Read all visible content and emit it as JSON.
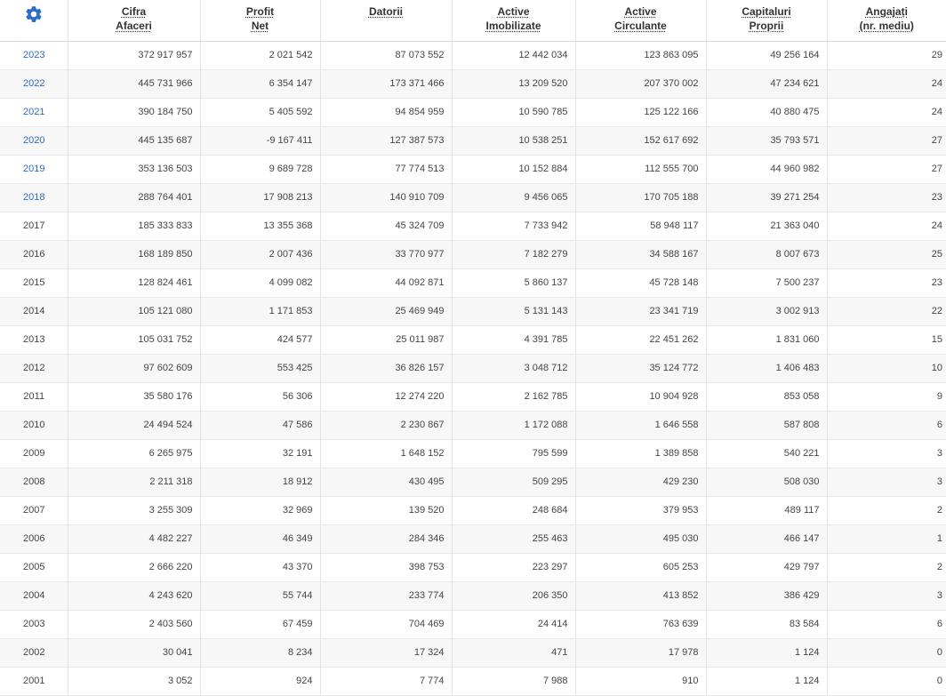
{
  "settings_icon": "gear-icon",
  "accent_color": "#2a6cc7",
  "columns": [
    {
      "line1": "Cifra",
      "line2": "Afaceri"
    },
    {
      "line1": "Profit",
      "line2": "Net"
    },
    {
      "line1": "Datorii",
      "line2": ""
    },
    {
      "line1": "Active",
      "line2": "Imobilizate"
    },
    {
      "line1": "Active",
      "line2": "Circulante"
    },
    {
      "line1": "Capitaluri",
      "line2": "Proprii"
    },
    {
      "line1": "Angajați",
      "line2": "(nr. mediu)"
    }
  ],
  "rows": [
    {
      "year": "2023",
      "link": true,
      "values": [
        "372 917 957",
        "2 021 542",
        "87 073 552",
        "12 442 034",
        "123 863 095",
        "49 256 164",
        "29"
      ]
    },
    {
      "year": "2022",
      "link": true,
      "values": [
        "445 731 966",
        "6 354 147",
        "173 371 466",
        "13 209 520",
        "207 370 002",
        "47 234 621",
        "24"
      ]
    },
    {
      "year": "2021",
      "link": true,
      "values": [
        "390 184 750",
        "5 405 592",
        "94 854 959",
        "10 590 785",
        "125 122 166",
        "40 880 475",
        "24"
      ]
    },
    {
      "year": "2020",
      "link": true,
      "values": [
        "445 135 687",
        "-9 167 411",
        "127 387 573",
        "10 538 251",
        "152 617 692",
        "35 793 571",
        "27"
      ]
    },
    {
      "year": "2019",
      "link": true,
      "values": [
        "353 136 503",
        "9 689 728",
        "77 774 513",
        "10 152 884",
        "112 555 700",
        "44 960 982",
        "27"
      ]
    },
    {
      "year": "2018",
      "link": true,
      "values": [
        "288 764 401",
        "17 908 213",
        "140 910 709",
        "9 456 065",
        "170 705 188",
        "39 271 254",
        "23"
      ]
    },
    {
      "year": "2017",
      "link": false,
      "values": [
        "185 333 833",
        "13 355 368",
        "45 324 709",
        "7 733 942",
        "58 948 117",
        "21 363 040",
        "24"
      ]
    },
    {
      "year": "2016",
      "link": false,
      "values": [
        "168 189 850",
        "2 007 436",
        "33 770 977",
        "7 182 279",
        "34 588 167",
        "8 007 673",
        "25"
      ]
    },
    {
      "year": "2015",
      "link": false,
      "values": [
        "128 824 461",
        "4 099 082",
        "44 092 871",
        "5 860 137",
        "45 728 148",
        "7 500 237",
        "23"
      ]
    },
    {
      "year": "2014",
      "link": false,
      "values": [
        "105 121 080",
        "1 171 853",
        "25 469 949",
        "5 131 143",
        "23 341 719",
        "3 002 913",
        "22"
      ]
    },
    {
      "year": "2013",
      "link": false,
      "values": [
        "105 031 752",
        "424 577",
        "25 011 987",
        "4 391 785",
        "22 451 262",
        "1 831 060",
        "15"
      ]
    },
    {
      "year": "2012",
      "link": false,
      "values": [
        "97 602 609",
        "553 425",
        "36 826 157",
        "3 048 712",
        "35 124 772",
        "1 406 483",
        "10"
      ]
    },
    {
      "year": "2011",
      "link": false,
      "values": [
        "35 580 176",
        "56 306",
        "12 274 220",
        "2 162 785",
        "10 904 928",
        "853 058",
        "9"
      ]
    },
    {
      "year": "2010",
      "link": false,
      "values": [
        "24 494 524",
        "47 586",
        "2 230 867",
        "1 172 088",
        "1 646 558",
        "587 808",
        "6"
      ]
    },
    {
      "year": "2009",
      "link": false,
      "values": [
        "6 265 975",
        "32 191",
        "1 648 152",
        "795 599",
        "1 389 858",
        "540 221",
        "3"
      ]
    },
    {
      "year": "2008",
      "link": false,
      "values": [
        "2 211 318",
        "18 912",
        "430 495",
        "509 295",
        "429 230",
        "508 030",
        "3"
      ]
    },
    {
      "year": "2007",
      "link": false,
      "values": [
        "3 255 309",
        "32 969",
        "139 520",
        "248 684",
        "379 953",
        "489 117",
        "2"
      ]
    },
    {
      "year": "2006",
      "link": false,
      "values": [
        "4 482 227",
        "46 349",
        "284 346",
        "255 463",
        "495 030",
        "466 147",
        "1"
      ]
    },
    {
      "year": "2005",
      "link": false,
      "values": [
        "2 666 220",
        "43 370",
        "398 753",
        "223 297",
        "605 253",
        "429 797",
        "2"
      ]
    },
    {
      "year": "2004",
      "link": false,
      "values": [
        "4 243 620",
        "55 744",
        "233 774",
        "206 350",
        "413 852",
        "386 429",
        "3"
      ]
    },
    {
      "year": "2003",
      "link": false,
      "values": [
        "2 403 560",
        "67 459",
        "704 469",
        "24 414",
        "763 639",
        "83 584",
        "6"
      ]
    },
    {
      "year": "2002",
      "link": false,
      "values": [
        "30 041",
        "8 234",
        "17 324",
        "471",
        "17 978",
        "1 124",
        "0"
      ]
    },
    {
      "year": "2001",
      "link": false,
      "values": [
        "3 052",
        "924",
        "7 774",
        "7 988",
        "910",
        "1 124",
        "0"
      ]
    }
  ]
}
